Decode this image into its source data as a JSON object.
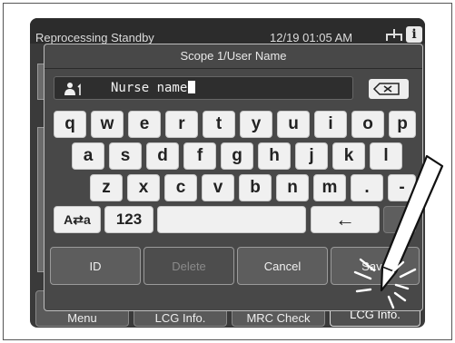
{
  "status": {
    "mode": "Reprocessing Standby",
    "datetime": "12/19 01:05 AM",
    "info_label": "i"
  },
  "dialog": {
    "title": "Scope 1/User Name",
    "input_value": "Nurse name"
  },
  "keyboard": {
    "row1": [
      "q",
      "w",
      "e",
      "r",
      "t",
      "y",
      "u",
      "i",
      "o",
      "p"
    ],
    "row2": [
      "a",
      "s",
      "d",
      "f",
      "g",
      "h",
      "j",
      "k",
      "l"
    ],
    "row3": [
      "z",
      "x",
      "c",
      "v",
      "b",
      "n",
      "m",
      ".",
      "-"
    ],
    "mode_key": "A⇄a",
    "numbers_key": "123",
    "left_arrow": "←"
  },
  "buttons": {
    "id": "ID",
    "delete": "Delete",
    "cancel": "Cancel",
    "save": "Save"
  },
  "background_menu": {
    "menu": "Menu",
    "leg_info_1": "LCG Info.",
    "mrc_check": "MRC Check",
    "leg_info_2": "LCG Info."
  }
}
